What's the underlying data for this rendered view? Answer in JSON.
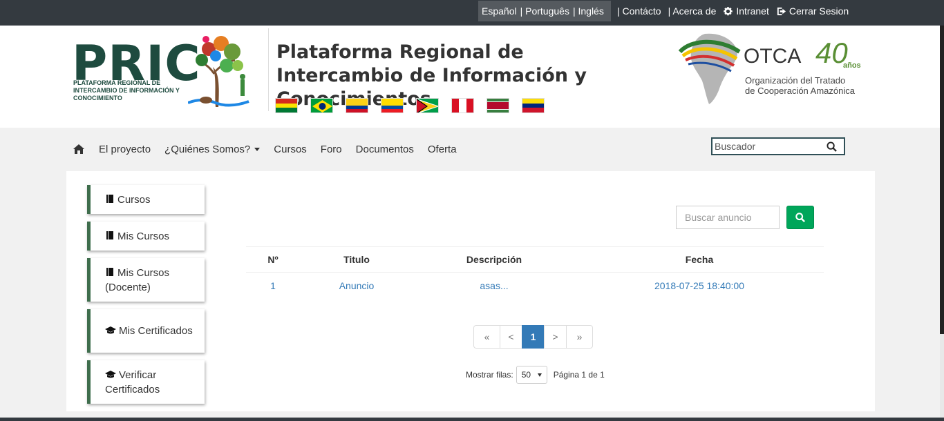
{
  "topbar": {
    "languages": [
      "Español",
      "| Português",
      "| Inglés"
    ],
    "links": [
      "| Contácto",
      "| Acerca de",
      "Intranet",
      "Cerrar Sesion"
    ]
  },
  "header": {
    "logo_text": "PRIC",
    "logo_subtitle": "PLATAFORMA REGIONAL DE INTERCAMBIO DE INFORMACIÓN Y CONOCIMIENTO",
    "title": "Plataforma Regional de Intercambio de Información y Conocimientos",
    "otca_name": "OTCA",
    "otca_40": "40",
    "otca_anos": "años",
    "otca_subtitle_1": "Organización del Tratado",
    "otca_subtitle_2": "de Cooperación Amazónica",
    "flags": [
      "bolivia-flag",
      "brazil-flag",
      "colombia-flag",
      "ecuador-flag",
      "guyana-flag",
      "peru-flag",
      "suriname-flag",
      "venezuela-flag"
    ]
  },
  "nav": {
    "items": [
      "El proyecto",
      "¿Quiénes Somos?",
      "Cursos",
      "Foro",
      "Documentos",
      "Oferta"
    ],
    "search_placeholder": "Buscador"
  },
  "sidebar": {
    "items": [
      {
        "label": "Cursos",
        "icon": "book-icon"
      },
      {
        "label": "Mis Cursos",
        "icon": "book-icon"
      },
      {
        "label": "Mis Cursos (Docente)",
        "icon": "book-icon"
      },
      {
        "label": "Mis Certificados",
        "icon": "graduation-cap-icon"
      },
      {
        "label": "Verificar Certificados",
        "icon": "graduation-cap-icon"
      }
    ]
  },
  "announcements": {
    "search_placeholder": "Buscar anuncio",
    "columns": [
      "Nº",
      "Titulo",
      "Descripción",
      "Fecha"
    ],
    "rows": [
      {
        "n": "1",
        "titulo": "Anuncio",
        "descripcion": "asas...",
        "fecha": "2018-07-25 18:40:00"
      }
    ],
    "pagination": {
      "first": "«",
      "prev": "<",
      "current": "1",
      "next": ">",
      "last": "»"
    },
    "rows_label": "Mostrar filas:",
    "rows_value": "50",
    "page_info": "Página 1 de 1"
  },
  "colors": {
    "topbar": "#343a40",
    "sidebar_accent": "#3e6d4c",
    "primary": "#337ab7",
    "success": "#00a65a"
  }
}
